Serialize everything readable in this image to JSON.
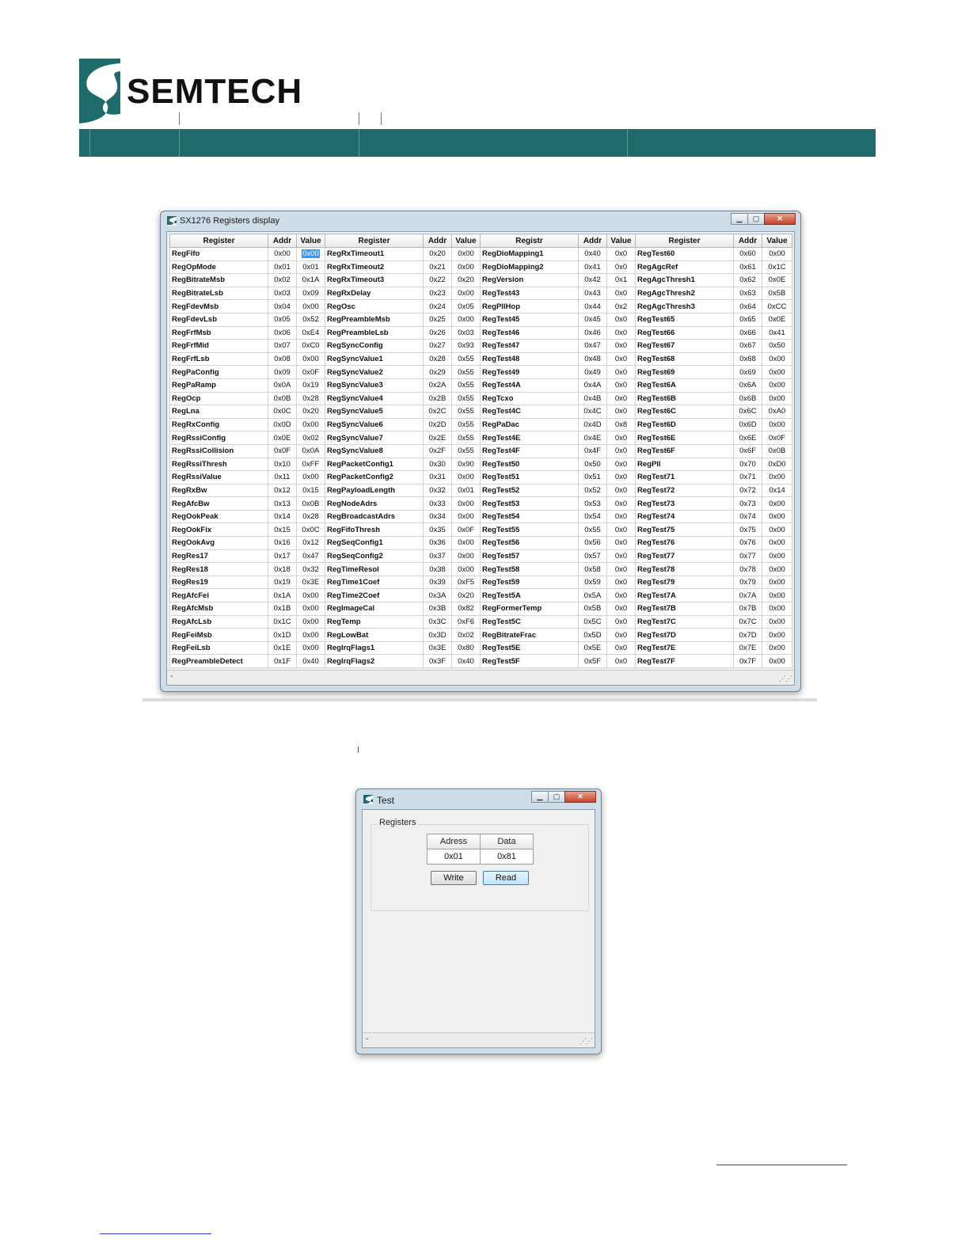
{
  "header": {
    "brand": "SEMTECH"
  },
  "registers_window": {
    "title": "SX1276 Registers display",
    "columns": [
      {
        "register": "Register",
        "addr": "Addr",
        "value": "Value"
      },
      {
        "register": "Register",
        "addr": "Addr",
        "value": "Value"
      },
      {
        "register": "Registr",
        "addr": "Addr",
        "value": "Value"
      },
      {
        "register": "Register",
        "addr": "Addr",
        "value": "Value"
      }
    ],
    "rows": [
      [
        "RegFifo",
        "0x00",
        "0x00",
        "RegRxTimeout1",
        "0x20",
        "0x00",
        "RegDioMapping1",
        "0x40",
        "0x0",
        "RegTest60",
        "0x60",
        "0x00"
      ],
      [
        "RegOpMode",
        "0x01",
        "0x01",
        "RegRxTimeout2",
        "0x21",
        "0x00",
        "RegDioMapping2",
        "0x41",
        "0x0",
        "RegAgcRef",
        "0x61",
        "0x1C"
      ],
      [
        "RegBitrateMsb",
        "0x02",
        "0x1A",
        "RegRxTimeout3",
        "0x22",
        "0x20",
        "RegVersion",
        "0x42",
        "0x1",
        "RegAgcThresh1",
        "0x62",
        "0x0E"
      ],
      [
        "RegBitrateLsb",
        "0x03",
        "0x09",
        "RegRxDelay",
        "0x23",
        "0x00",
        "RegTest43",
        "0x43",
        "0x0",
        "RegAgcThresh2",
        "0x63",
        "0x5B"
      ],
      [
        "RegFdevMsb",
        "0x04",
        "0x00",
        "RegOsc",
        "0x24",
        "0x05",
        "RegPllHop",
        "0x44",
        "0x2",
        "RegAgcThresh3",
        "0x64",
        "0xCC"
      ],
      [
        "RegFdevLsb",
        "0x05",
        "0x52",
        "RegPreambleMsb",
        "0x25",
        "0x00",
        "RegTest45",
        "0x45",
        "0x0",
        "RegTest65",
        "0x65",
        "0x0E"
      ],
      [
        "RegFrfMsb",
        "0x06",
        "0xE4",
        "RegPreambleLsb",
        "0x26",
        "0x03",
        "RegTest46",
        "0x46",
        "0x0",
        "RegTest66",
        "0x66",
        "0x41"
      ],
      [
        "RegFrfMid",
        "0x07",
        "0xC0",
        "RegSyncConfig",
        "0x27",
        "0x93",
        "RegTest47",
        "0x47",
        "0x0",
        "RegTest67",
        "0x67",
        "0x50"
      ],
      [
        "RegFrfLsb",
        "0x08",
        "0x00",
        "RegSyncValue1",
        "0x28",
        "0x55",
        "RegTest48",
        "0x48",
        "0x0",
        "RegTest68",
        "0x68",
        "0x00"
      ],
      [
        "RegPaConfig",
        "0x09",
        "0x0F",
        "RegSyncValue2",
        "0x29",
        "0x55",
        "RegTest49",
        "0x49",
        "0x0",
        "RegTest69",
        "0x69",
        "0x00"
      ],
      [
        "RegPaRamp",
        "0x0A",
        "0x19",
        "RegSyncValue3",
        "0x2A",
        "0x55",
        "RegTest4A",
        "0x4A",
        "0x0",
        "RegTest6A",
        "0x6A",
        "0x00"
      ],
      [
        "RegOcp",
        "0x0B",
        "0x28",
        "RegSyncValue4",
        "0x2B",
        "0x55",
        "RegTcxo",
        "0x4B",
        "0x0",
        "RegTest6B",
        "0x6B",
        "0x00"
      ],
      [
        "RegLna",
        "0x0C",
        "0x20",
        "RegSyncValue5",
        "0x2C",
        "0x55",
        "RegTest4C",
        "0x4C",
        "0x0",
        "RegTest6C",
        "0x6C",
        "0xA0"
      ],
      [
        "RegRxConfig",
        "0x0D",
        "0x00",
        "RegSyncValue6",
        "0x2D",
        "0x55",
        "RegPaDac",
        "0x4D",
        "0x8",
        "RegTest6D",
        "0x6D",
        "0x00"
      ],
      [
        "RegRssiConfig",
        "0x0E",
        "0x02",
        "RegSyncValue7",
        "0x2E",
        "0x55",
        "RegTest4E",
        "0x4E",
        "0x0",
        "RegTest6E",
        "0x6E",
        "0x0F"
      ],
      [
        "RegRssiCollision",
        "0x0F",
        "0x0A",
        "RegSyncValue8",
        "0x2F",
        "0x55",
        "RegTest4F",
        "0x4F",
        "0x0",
        "RegTest6F",
        "0x6F",
        "0x0B"
      ],
      [
        "RegRssiThresh",
        "0x10",
        "0xFF",
        "RegPacketConfig1",
        "0x30",
        "0x90",
        "RegTest50",
        "0x50",
        "0x0",
        "RegPll",
        "0x70",
        "0xD0"
      ],
      [
        "RegRssiValue",
        "0x11",
        "0x00",
        "RegPacketConfig2",
        "0x31",
        "0x00",
        "RegTest51",
        "0x51",
        "0x0",
        "RegTest71",
        "0x71",
        "0x00"
      ],
      [
        "RegRxBw",
        "0x12",
        "0x15",
        "RegPayloadLength",
        "0x32",
        "0x01",
        "RegTest52",
        "0x52",
        "0x0",
        "RegTest72",
        "0x72",
        "0x14"
      ],
      [
        "RegAfcBw",
        "0x13",
        "0x0B",
        "RegNodeAdrs",
        "0x33",
        "0x00",
        "RegTest53",
        "0x53",
        "0x0",
        "RegTest73",
        "0x73",
        "0x00"
      ],
      [
        "RegOokPeak",
        "0x14",
        "0x28",
        "RegBroadcastAdrs",
        "0x34",
        "0x00",
        "RegTest54",
        "0x54",
        "0x0",
        "RegTest74",
        "0x74",
        "0x00"
      ],
      [
        "RegOokFix",
        "0x15",
        "0x0C",
        "RegFifoThresh",
        "0x35",
        "0x0F",
        "RegTest55",
        "0x55",
        "0x0",
        "RegTest75",
        "0x75",
        "0x00"
      ],
      [
        "RegOokAvg",
        "0x16",
        "0x12",
        "RegSeqConfig1",
        "0x36",
        "0x00",
        "RegTest56",
        "0x56",
        "0x0",
        "RegTest76",
        "0x76",
        "0x00"
      ],
      [
        "RegRes17",
        "0x17",
        "0x47",
        "RegSeqConfig2",
        "0x37",
        "0x00",
        "RegTest57",
        "0x57",
        "0x0",
        "RegTest77",
        "0x77",
        "0x00"
      ],
      [
        "RegRes18",
        "0x18",
        "0x32",
        "RegTimeResol",
        "0x38",
        "0x00",
        "RegTest58",
        "0x58",
        "0x0",
        "RegTest78",
        "0x78",
        "0x00"
      ],
      [
        "RegRes19",
        "0x19",
        "0x3E",
        "RegTime1Coef",
        "0x39",
        "0xF5",
        "RegTest59",
        "0x59",
        "0x0",
        "RegTest79",
        "0x79",
        "0x00"
      ],
      [
        "RegAfcFei",
        "0x1A",
        "0x00",
        "RegTime2Coef",
        "0x3A",
        "0x20",
        "RegTest5A",
        "0x5A",
        "0x0",
        "RegTest7A",
        "0x7A",
        "0x00"
      ],
      [
        "RegAfcMsb",
        "0x1B",
        "0x00",
        "RegImageCal",
        "0x3B",
        "0x82",
        "RegFormerTemp",
        "0x5B",
        "0x0",
        "RegTest7B",
        "0x7B",
        "0x00"
      ],
      [
        "RegAfcLsb",
        "0x1C",
        "0x00",
        "RegTemp",
        "0x3C",
        "0xF6",
        "RegTest5C",
        "0x5C",
        "0x0",
        "RegTest7C",
        "0x7C",
        "0x00"
      ],
      [
        "RegFeiMsb",
        "0x1D",
        "0x00",
        "RegLowBat",
        "0x3D",
        "0x02",
        "RegBitrateFrac",
        "0x5D",
        "0x0",
        "RegTest7D",
        "0x7D",
        "0x00"
      ],
      [
        "RegFeiLsb",
        "0x1E",
        "0x00",
        "RegIrqFlags1",
        "0x3E",
        "0x80",
        "RegTest5E",
        "0x5E",
        "0x0",
        "RegTest7E",
        "0x7E",
        "0x00"
      ],
      [
        "RegPreambleDetect",
        "0x1F",
        "0x40",
        "RegIrqFlags2",
        "0x3F",
        "0x40",
        "RegTest5F",
        "0x5F",
        "0x0",
        "RegTest7F",
        "0x7F",
        "0x00"
      ]
    ],
    "status_text": "-"
  },
  "test_window": {
    "title": "Test",
    "group_label": "Registers",
    "address_header": "Adress",
    "data_header": "Data",
    "address_value": "0x01",
    "data_value": "0x81",
    "write_label": "Write",
    "read_label": "Read",
    "status_text": "-"
  },
  "colors": {
    "brand": "#1f6b6c",
    "selection": "#3399ff"
  }
}
